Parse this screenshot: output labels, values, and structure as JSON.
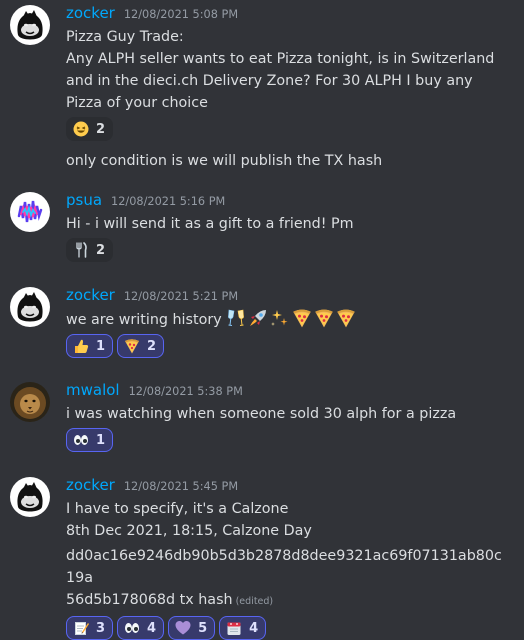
{
  "messages": [
    {
      "author": "zocker",
      "timestamp": "12/08/2021 5:08 PM",
      "avatar": "gorilla-avatar",
      "lines": [
        "Pizza Guy Trade:",
        "Any ALPH seller wants to eat Pizza tonight, is in Switzerland and in the dieci.ch Delivery Zone? For 30 ALPH I buy any Pizza of your choice"
      ],
      "reactions": [
        {
          "emoji": "laughing-face",
          "count": "2",
          "me": false
        }
      ],
      "followup": "only condition is we will publish the TX hash"
    },
    {
      "author": "psua",
      "timestamp": "12/08/2021 5:16 PM",
      "avatar": "wave-avatar",
      "lines": [
        "Hi - i will send it as a gift to a friend! Pm"
      ],
      "reactions": [
        {
          "emoji": "fork-knife",
          "count": "2",
          "me": false
        }
      ]
    },
    {
      "author": "zocker",
      "timestamp": "12/08/2021 5:21 PM",
      "avatar": "gorilla-avatar",
      "text": "we are writing history",
      "inline_emojis": [
        "champagne-glasses",
        "rocket",
        "sparkles",
        "pizza",
        "pizza",
        "pizza"
      ],
      "reactions": [
        {
          "emoji": "thumbs-up",
          "count": "1",
          "me": true
        },
        {
          "emoji": "pizza",
          "count": "2",
          "me": true
        }
      ]
    },
    {
      "author": "mwalol",
      "timestamp": "12/08/2021 5:38 PM",
      "avatar": "lion-avatar",
      "lines": [
        "i was watching when someone sold 30 alph for a pizza"
      ],
      "reactions": [
        {
          "emoji": "eyes",
          "count": "1",
          "me": true
        }
      ]
    },
    {
      "author": "zocker",
      "timestamp": "12/08/2021 5:45 PM",
      "avatar": "gorilla-avatar",
      "lines": [
        "I have to specify, it's a Calzone",
        "8th Dec 2021, 18:15, Calzone Day"
      ],
      "hash_line_1": "dd0ac16e9246db90b5d3b2878d8dee9321ac69f07131ab80c19a",
      "hash_line_2": "56d5b178068d tx hash",
      "edited": "(edited)",
      "reactions": [
        {
          "emoji": "memo",
          "count": "3",
          "me": true
        },
        {
          "emoji": "eyes",
          "count": "4",
          "me": true
        },
        {
          "emoji": "purple-heart",
          "count": "5",
          "me": true
        },
        {
          "emoji": "calendar",
          "count": "4",
          "me": true
        }
      ]
    }
  ],
  "colors": {
    "background": "#313338",
    "username": "#00a8fc",
    "text": "#dbdee1",
    "reaction_active": "#373a6b",
    "reaction_border": "#5865f2"
  }
}
